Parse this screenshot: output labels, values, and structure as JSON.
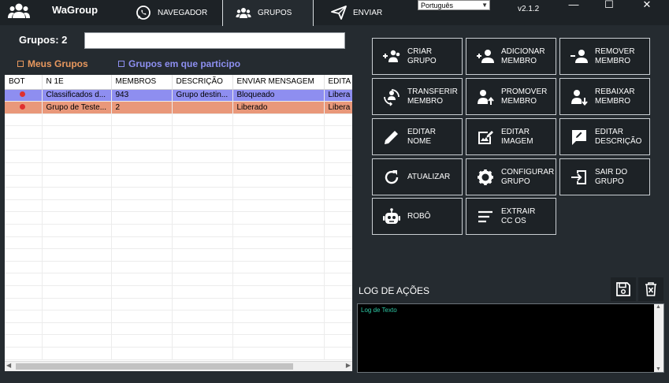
{
  "app": {
    "title": "WaGroup",
    "version": "v2.1.2",
    "language": "Português"
  },
  "nav": {
    "tabs": [
      {
        "label": "NAVEGADOR",
        "icon": "whatsapp-icon"
      },
      {
        "label": "GRUPOS",
        "icon": "users-icon",
        "active": true
      },
      {
        "label": "ENVIAR",
        "icon": "send-icon"
      }
    ]
  },
  "window_controls": {
    "minimize": "—",
    "maximize": "☐",
    "close": "✕"
  },
  "groups": {
    "count_label": "Grupos: 2",
    "search_value": "",
    "filters": {
      "mine": "Meus Grupos",
      "participating": "Grupos em que participo"
    },
    "columns": [
      "BOT",
      "N  1E",
      "MEMBROS",
      "DESCRIÇÃO",
      "ENVIAR MENSAGEM",
      "EDITA"
    ],
    "rows": [
      {
        "name": "Classificados d...",
        "members": "943",
        "description": "Grupo destin...",
        "send": "Bloqueado",
        "edit": "Libera"
      },
      {
        "name": "Grupo de Teste...",
        "members": "2",
        "description": "",
        "send": "Liberado",
        "edit": "Libera"
      }
    ]
  },
  "actions": [
    {
      "label": "CRIAR\nGRUPO",
      "icon": "add-group-icon"
    },
    {
      "label": "ADICIONAR\nMEMBRO",
      "icon": "add-member-icon"
    },
    {
      "label": "REMOVER\nMEMBRO",
      "icon": "remove-member-icon"
    },
    {
      "label": "TRANSFERIR\nMEMBRO",
      "icon": "transfer-icon"
    },
    {
      "label": "PROMOVER\nMEMBRO",
      "icon": "promote-icon"
    },
    {
      "label": "REBAIXAR\nMEMBRO",
      "icon": "demote-icon"
    },
    {
      "label": "EDITAR\nNOME",
      "icon": "pencil-icon"
    },
    {
      "label": "EDITAR\nIMAGEM",
      "icon": "edit-image-icon"
    },
    {
      "label": "EDITAR\nDESCRIÇÃO",
      "icon": "edit-description-icon"
    },
    {
      "label": "ATUALIZAR",
      "icon": "refresh-icon"
    },
    {
      "label": "CONFIGURAR\nGRUPO",
      "icon": "gear-icon"
    },
    {
      "label": "SAIR DO\nGRUPO",
      "icon": "exit-icon"
    },
    {
      "label": "ROBÔ",
      "icon": "robot-icon"
    },
    {
      "label": "EXTRAIR\nCC        OS",
      "icon": "list-icon"
    }
  ],
  "log": {
    "title": "LOG DE AÇÕES",
    "text": "Log de Texto"
  },
  "colors": {
    "background": "#252b30",
    "bar": "#1d2226",
    "row_blocked": "#8e8ef0",
    "row_free": "#e9987a",
    "mine_filter": "#e8985e",
    "participating_filter": "#8d8ff0",
    "log_text": "#2ec9a6"
  }
}
